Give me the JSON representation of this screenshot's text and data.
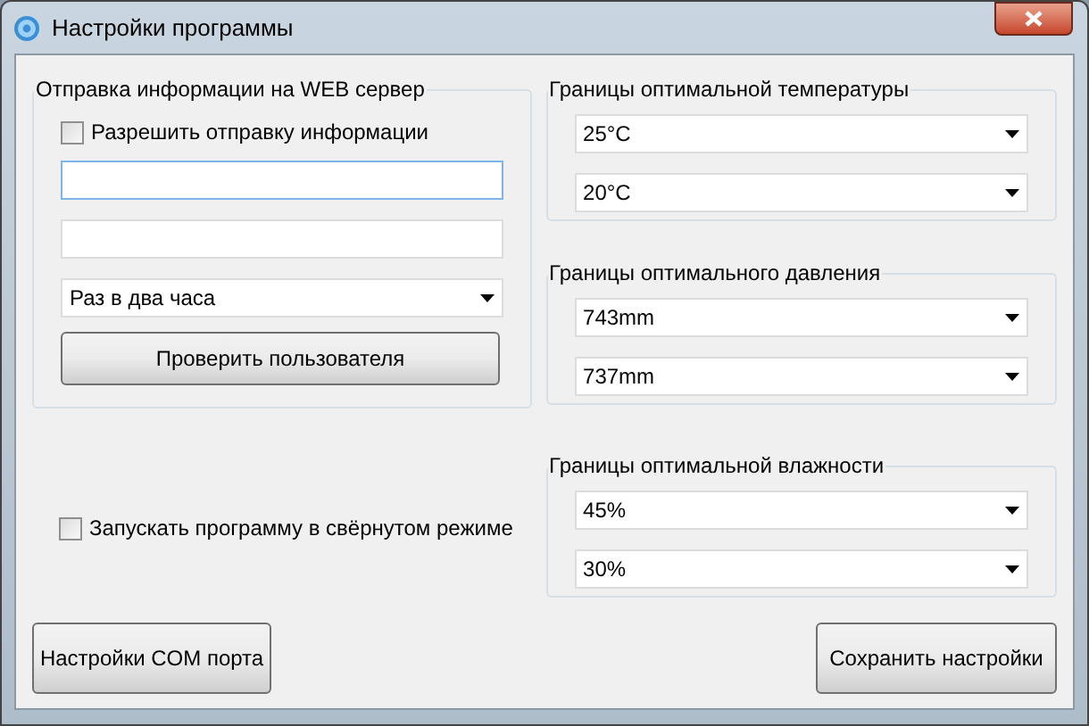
{
  "window": {
    "title": "Настройки программы"
  },
  "web_group": {
    "title": "Отправка информации на WEB сервер",
    "allow_checkbox": {
      "label": "Разрешить отправку информации",
      "checked": false
    },
    "fields": [
      {
        "focused": true
      },
      {
        "focused": false
      }
    ],
    "interval": {
      "value": "Раз в два часа"
    },
    "check_button": "Проверить пользователя"
  },
  "minimized_checkbox": {
    "label": "Запускать программу в свёрнутом режиме",
    "checked": false
  },
  "range_groups": [
    {
      "title": "Границы оптимальной температуры",
      "values": [
        "25°C",
        "20°C"
      ]
    },
    {
      "title": "Границы оптимального давления",
      "values": [
        "743mm",
        "737mm"
      ]
    },
    {
      "title": "Границы оптимальной влажности",
      "values": [
        "45%",
        "30%"
      ]
    }
  ],
  "buttons": [
    {
      "label": "Настройки COM порта"
    },
    {
      "label": "Сохранить настройки"
    }
  ]
}
